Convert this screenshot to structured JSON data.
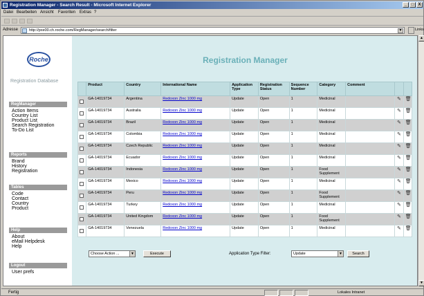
{
  "window": {
    "title": "Registration Manager - Search Result - Microsoft Internet Explorer",
    "controls": [
      "_",
      "□",
      "X"
    ]
  },
  "menu": [
    "Datei",
    "Bearbeiten",
    "Ansicht",
    "Favoriten",
    "Extras",
    "?"
  ],
  "address": {
    "label": "Adresse",
    "url": "http://pxe00.ch.roche.com/RegManager/search/filter",
    "links_label": "Links"
  },
  "sidebar": {
    "logo": "Roche",
    "app_name": "Registration Database",
    "sections": [
      {
        "header": "RegManager",
        "items": [
          "Action Items",
          "Country List",
          "Product List",
          "Search Registration",
          "To-Do List"
        ]
      },
      {
        "header": "Reports",
        "items": [
          "Brand",
          "History",
          "Registration"
        ]
      },
      {
        "header": "Tables",
        "items": [
          "Code",
          "Contact",
          "Country",
          "Product"
        ]
      },
      {
        "header": "Help",
        "items": [
          "About",
          "eMail Helpdesk",
          "Help"
        ]
      },
      {
        "header": "Logout",
        "items": [
          "User prefs"
        ]
      }
    ]
  },
  "page": {
    "title": "Registration Manager"
  },
  "table": {
    "columns": [
      "",
      "Product",
      "Country",
      "International Name",
      "Application Type",
      "Registration Status",
      "Sequence Number",
      "Category",
      "Comment",
      "",
      ""
    ],
    "rows": [
      {
        "product": "GA-14019734",
        "country": "Argentina",
        "name": "Redoxon Zinc 1000 mg",
        "app_type": "Update",
        "status": "Open",
        "seq": "1",
        "category": "Medicinal",
        "comment": ""
      },
      {
        "product": "GA-14019734",
        "country": "Australia",
        "name": "Redoxon Zinc 1000 mg",
        "app_type": "Update",
        "status": "Open",
        "seq": "1",
        "category": "Medicinal",
        "comment": ""
      },
      {
        "product": "GA-14019734",
        "country": "Brazil",
        "name": "Redoxon Zinc 1000 mg",
        "app_type": "Update",
        "status": "Open",
        "seq": "1",
        "category": "Medicinal",
        "comment": ""
      },
      {
        "product": "GA-14019734",
        "country": "Colombia",
        "name": "Redoxon Zinc 1000 mg",
        "app_type": "Update",
        "status": "Open",
        "seq": "1",
        "category": "Medicinal",
        "comment": ""
      },
      {
        "product": "GA-14019734",
        "country": "Czech Republic",
        "name": "Redoxon Zinc 1000 mg",
        "app_type": "Update",
        "status": "Open",
        "seq": "1",
        "category": "Medicinal",
        "comment": ""
      },
      {
        "product": "GA-14019734",
        "country": "Ecuador",
        "name": "Redoxon Zinc 1000 mg",
        "app_type": "Update",
        "status": "Open",
        "seq": "1",
        "category": "Medicinal",
        "comment": ""
      },
      {
        "product": "GA-14019734",
        "country": "Indonesia",
        "name": "Redoxon Zinc 1000 mg",
        "app_type": "Update",
        "status": "Open",
        "seq": "1",
        "category": "Food Supplement",
        "comment": ""
      },
      {
        "product": "GA-14019734",
        "country": "Mexico",
        "name": "Redoxon Zinc 1000 mg",
        "app_type": "Update",
        "status": "Open",
        "seq": "1",
        "category": "Medicinal",
        "comment": ""
      },
      {
        "product": "GA-14019734",
        "country": "Peru",
        "name": "Redoxon Zinc 1000 mg",
        "app_type": "Update",
        "status": "Open",
        "seq": "1",
        "category": "Food Supplement",
        "comment": ""
      },
      {
        "product": "GA-14019734",
        "country": "Turkey",
        "name": "Redoxon Zinc 1000 mg",
        "app_type": "Update",
        "status": "Open",
        "seq": "1",
        "category": "Medicinal",
        "comment": ""
      },
      {
        "product": "GA-14019734",
        "country": "United Kingdom",
        "name": "Redoxon Zinc 1000 mg",
        "app_type": "Update",
        "status": "Open",
        "seq": "1",
        "category": "Food Supplement",
        "comment": ""
      },
      {
        "product": "GA-14019734",
        "country": "Venezuela",
        "name": "Redoxon Zinc 1000 mg",
        "app_type": "Update",
        "status": "Open",
        "seq": "1",
        "category": "Medicinal",
        "comment": ""
      }
    ]
  },
  "controls": {
    "action_select": "Choose Action ...",
    "execute_button": "Execute",
    "filter_label": "Application Type Filter:",
    "filter_select": "Update",
    "search_button": "Search"
  },
  "status": {
    "text": "Fertig",
    "zone": "Lokales Intranet"
  },
  "colors": {
    "main_bg": "#d8ecee",
    "title": "#6ab0b8",
    "header_bg": "#c0dde0",
    "alt_row": "#d0d0d0",
    "nav_header": "#9a9a9a"
  },
  "icons": [
    "ie-page-icon",
    "edit-pencil-icon",
    "trash-icon",
    "checkbox-icon"
  ]
}
